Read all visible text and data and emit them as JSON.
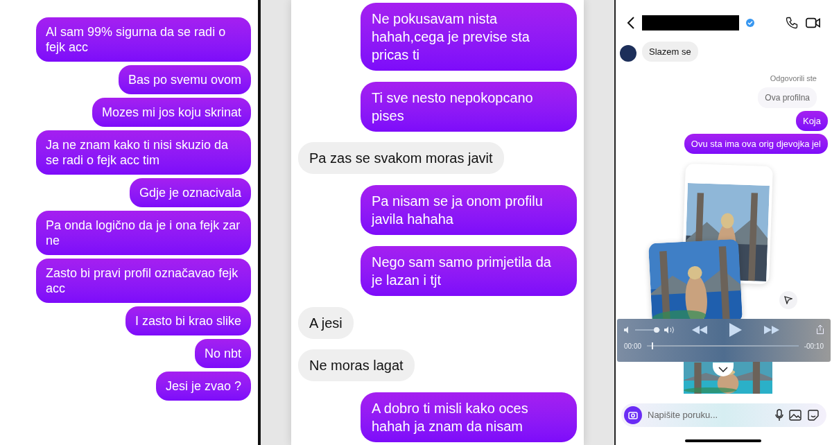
{
  "left_chat": {
    "messages": [
      {
        "kind": "sent",
        "text": "Al sam 99% sigurna da se radi o fejk acc"
      },
      {
        "kind": "sent",
        "text": "Bas po svemu ovom"
      },
      {
        "kind": "sent",
        "text": "Mozes mi jos koju skrinat"
      },
      {
        "kind": "sent",
        "text": "Ja ne znam kako ti nisi skuzio da se radi o fejk acc tim"
      },
      {
        "kind": "sent",
        "text": "Gdje je oznacivala"
      },
      {
        "kind": "sent",
        "text": "Pa onda logično da je i ona fejk zar ne"
      },
      {
        "kind": "sent",
        "text": "Zasto bi pravi profil označavao fejk acc"
      },
      {
        "kind": "sent",
        "text": "I zasto bi krao slike"
      },
      {
        "kind": "sent",
        "text": "No nbt"
      },
      {
        "kind": "sent",
        "text": "Jesi je zvao ?"
      }
    ]
  },
  "middle_chat": {
    "messages": [
      {
        "kind": "sent",
        "text": "Ne pokusavam nista hahah,cega je previse sta pricas ti"
      },
      {
        "kind": "sent",
        "text": "Ti sve nesto nepokopcano pises"
      },
      {
        "kind": "received",
        "text": "Pa zas se svakom moras javit"
      },
      {
        "kind": "sent",
        "text": "Pa nisam se ja onom profilu javila hahaha"
      },
      {
        "kind": "sent",
        "text": "Nego sam samo primjetila da je lazan i tjt"
      },
      {
        "kind": "received",
        "text": "A jesi"
      },
      {
        "kind": "received",
        "text": "Ne moras lagat"
      },
      {
        "kind": "sent",
        "text": "A dobro ti misli kako oces hahah ja znam da nisam"
      }
    ]
  },
  "right_chat": {
    "header": {
      "verified": true
    },
    "messages": [
      {
        "kind": "received",
        "text": "Slazem se"
      },
      {
        "kind": "reply_label",
        "text": "Odgovorili ste"
      },
      {
        "kind": "quoted",
        "text": "Ova profilna"
      },
      {
        "kind": "sent",
        "text": "Koja"
      },
      {
        "kind": "sent",
        "text": "Ovu sta ima ova orig djevojka jel"
      }
    ],
    "player": {
      "volume": {
        "level": 0.85
      },
      "progress": {
        "level": 0.03
      },
      "elapsed": "00:00",
      "remaining": "-00:10"
    },
    "composer": {
      "placeholder": "Napišite poruku..."
    }
  }
}
